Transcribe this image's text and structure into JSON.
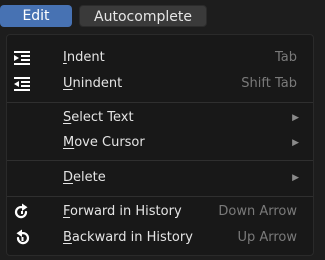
{
  "menubar": {
    "edit_label": "Edit",
    "autocomplete_label": "Autocomplete"
  },
  "menu": {
    "items": [
      {
        "key": "indent",
        "accel": "I",
        "rest": "ndent",
        "shortcut": "Tab",
        "icon": "indent-icon"
      },
      {
        "key": "unindent",
        "accel": "U",
        "rest": "nindent",
        "shortcut": "Shift Tab",
        "icon": "unindent-icon"
      },
      {
        "key": "select-text",
        "accel": "S",
        "rest": "elect Text",
        "submenu": true
      },
      {
        "key": "move-cursor",
        "accel": "M",
        "rest": "ove Cursor",
        "submenu": true
      },
      {
        "key": "delete",
        "accel": "D",
        "rest": "elete",
        "submenu": true
      },
      {
        "key": "forward-history",
        "accel": "F",
        "rest": "orward in History",
        "shortcut": "Down Arrow",
        "icon": "redo-icon"
      },
      {
        "key": "backward-history",
        "accel": "B",
        "rest": "ackward in History",
        "shortcut": "Up Arrow",
        "icon": "undo-icon"
      }
    ]
  },
  "colors": {
    "accent": "#4772b3",
    "menu_bg": "#181818",
    "text": "#e4e4e4",
    "shortcut_text": "#7a7a7a"
  }
}
